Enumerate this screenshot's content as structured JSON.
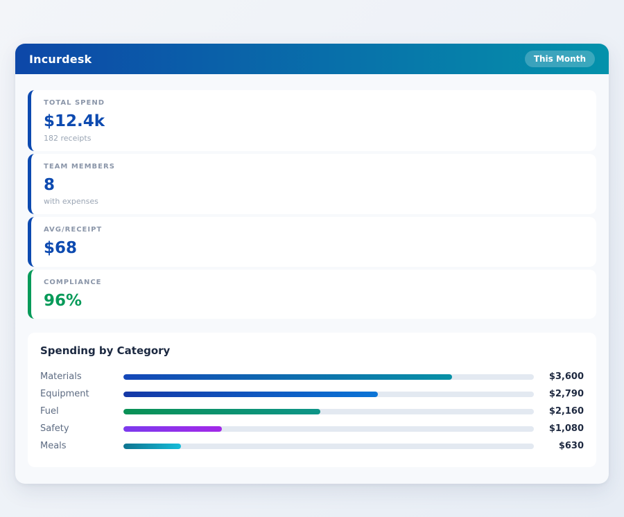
{
  "header": {
    "title": "Incurdesk",
    "badge_label": "This Month"
  },
  "colors": {
    "header_gradient_start": "#0d47a8",
    "header_gradient_end": "#0492ab",
    "stat_accent_blue": "#0d4ab0",
    "stat_accent_green": "#079a59",
    "bar_track": "#e3e9f1"
  },
  "stats": [
    {
      "label": "TOTAL SPEND",
      "value": "$12.4k",
      "sub": "182 receipts",
      "accent": "#0d4ab0"
    },
    {
      "label": "TEAM MEMBERS",
      "value": "8",
      "sub": "with expenses",
      "accent": "#0d4ab0"
    },
    {
      "label": "AVG/RECEIPT",
      "value": "$68",
      "sub": "",
      "accent": "#0d4ab0"
    },
    {
      "label": "COMPLIANCE",
      "value": "96%",
      "sub": "",
      "accent": "#079a59"
    }
  ],
  "chart_data": {
    "type": "bar",
    "title": "Spending by Category",
    "orientation": "horizontal",
    "categories": [
      "Materials",
      "Equipment",
      "Fuel",
      "Safety",
      "Meals"
    ],
    "values": [
      3600,
      2790,
      2160,
      1080,
      630
    ],
    "value_labels": [
      "$3,600",
      "$2,790",
      "$2,160",
      "$1,080",
      "$630"
    ],
    "xlim": [
      0,
      4500
    ],
    "grid": false,
    "legend": false,
    "bar_gradients": [
      [
        "#1447b8",
        "#0891a6"
      ],
      [
        "#1538a6",
        "#0b74d6"
      ],
      [
        "#0a9155",
        "#0e9488"
      ],
      [
        "#7c3aed",
        "#a228e8"
      ],
      [
        "#0e7490",
        "#16bcd9"
      ]
    ]
  }
}
